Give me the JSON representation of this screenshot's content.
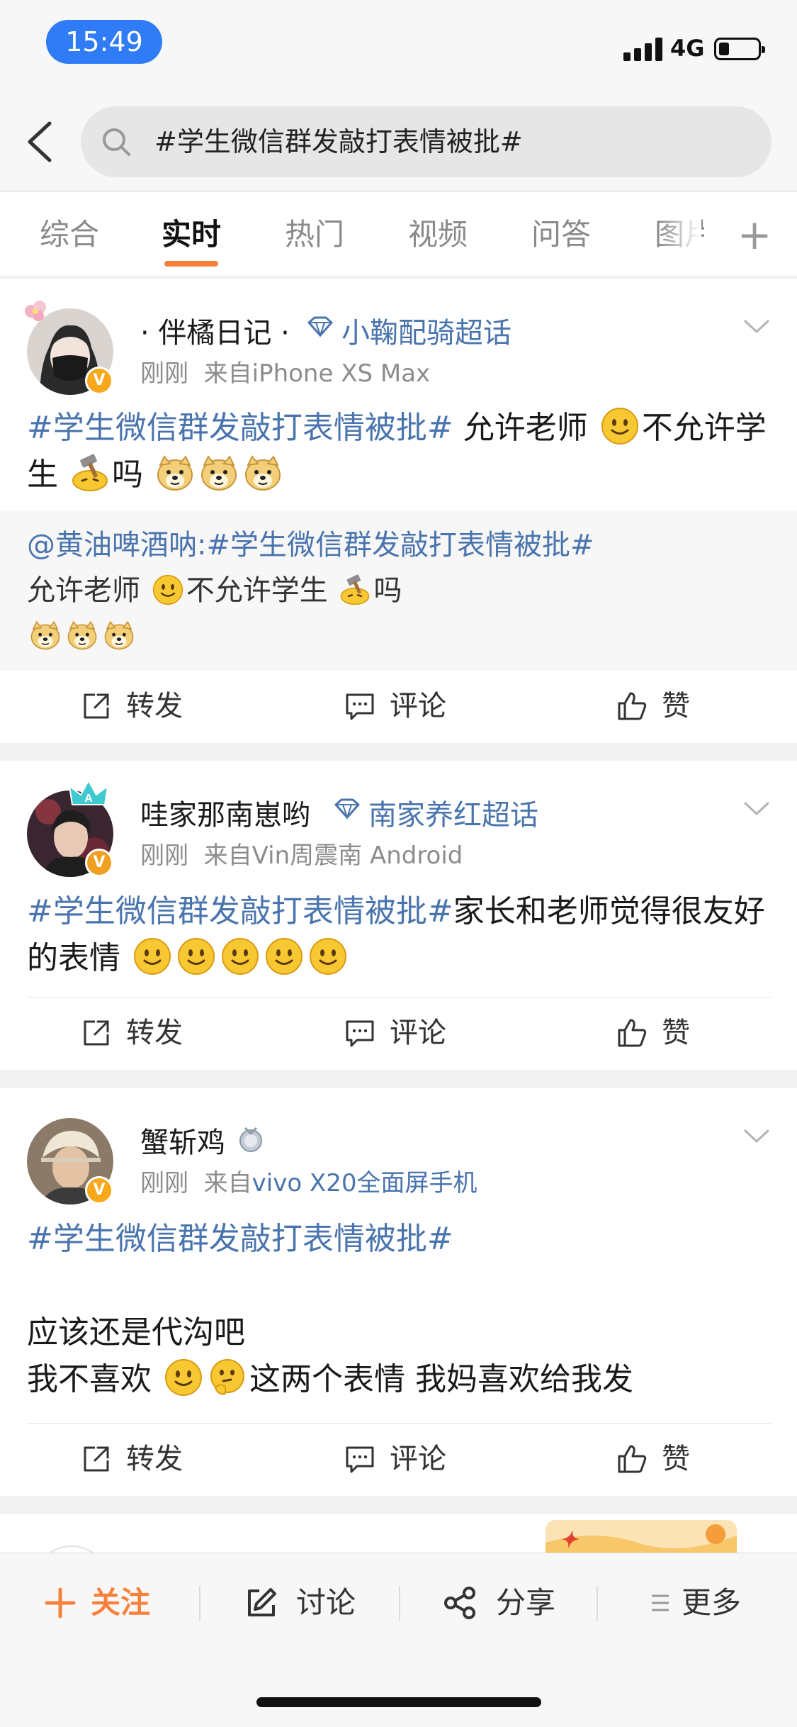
{
  "status_bar": {
    "time": "15:49",
    "network": "4G"
  },
  "search": {
    "query": "#学生微信群发敲打表情被批#"
  },
  "tabs": [
    {
      "label": "综合"
    },
    {
      "label": "实时"
    },
    {
      "label": "热门"
    },
    {
      "label": "视频"
    },
    {
      "label": "问答"
    },
    {
      "label": "图片"
    }
  ],
  "tab_plus": "+",
  "actions": {
    "repost": "转发",
    "comment": "评论",
    "like": "赞"
  },
  "posts": [
    {
      "name": "· 伴橘日记 ·",
      "super_topic": "小鞠配骑超话",
      "time": "刚刚",
      "from_label": "来自",
      "source": "iPhone XS Max",
      "hashtag": "#学生微信群发敲打表情被批#",
      "text_1": " 允许老师 ",
      "text_2": "不允许学生 ",
      "text_3": "吗 ",
      "repost": {
        "author": "@黄油啤酒呐:",
        "hashtag": "#学生微信群发敲打表情被批#",
        "text_1": "允许老师 ",
        "text_2": "不允许学生 ",
        "text_3": "吗"
      }
    },
    {
      "name": "哇家那南崽哟",
      "super_topic": "南家养红超话",
      "time": "刚刚",
      "from_label": "来自",
      "source": "Vin周震南 Android",
      "hashtag": "#学生微信群发敲打表情被批#",
      "text_1": "家长和老师觉得很友好的表情 "
    },
    {
      "name": "蟹斩鸡",
      "time": "刚刚",
      "from_label": "来自",
      "source": "vivo X20全面屏手机",
      "hashtag": "#学生微信群发敲打表情被批#",
      "line_2": "应该还是代沟吧",
      "line_3a": "我不喜欢 ",
      "line_3b": "这两个表情 我妈喜欢给我发"
    }
  ],
  "bottom_bar": {
    "follow": "关注",
    "discuss": "讨论",
    "share": "分享",
    "more": "更多"
  },
  "colors": {
    "accent": "#f7813a",
    "link": "#4a74ad",
    "time_pill": "#2f7cf6"
  }
}
